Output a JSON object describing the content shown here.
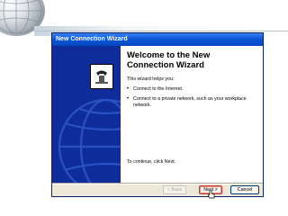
{
  "window": {
    "title": "New Connection Wizard"
  },
  "main": {
    "heading": "Welcome to the New Connection Wizard",
    "intro": "This wizard helps you:",
    "bullets": [
      "Connect to the Internet.",
      "Connect to a private network, such as your workplace network."
    ],
    "continue_text": "To continue, click Next."
  },
  "buttons": {
    "back": "< Back",
    "next": "Next >",
    "cancel": "Cancel"
  },
  "icons": {
    "wizard": "phone-icon",
    "slide_logo": "globe-icon"
  },
  "colors": {
    "titlebar": "#0a58d9",
    "side_panel": "#0e2d9a",
    "dialog_face": "#ece9d8",
    "next_highlight": "#c0392b"
  }
}
